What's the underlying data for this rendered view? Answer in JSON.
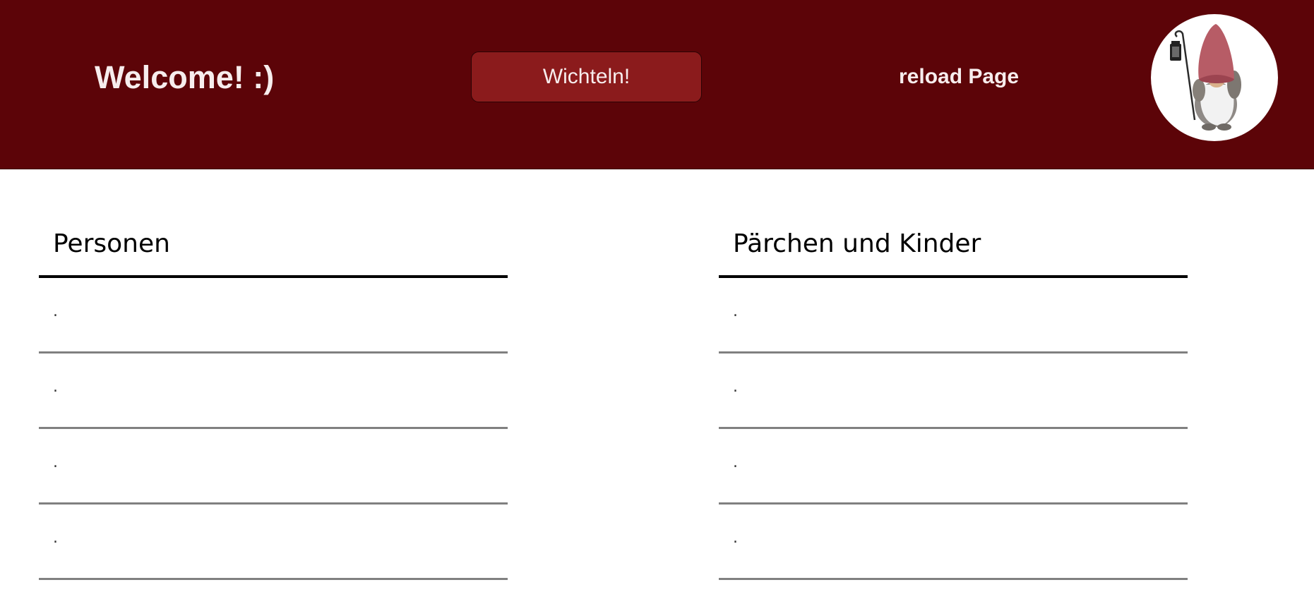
{
  "header": {
    "welcome_text": "Welcome! :)",
    "wichteln_button_label": "Wichteln!",
    "reload_link_label": "reload Page",
    "avatar_icon": "gnome-figurine-icon",
    "background_color": "#5c0408",
    "button_color": "#8b1b1c"
  },
  "lists": [
    {
      "title": "Personen",
      "items": [
        ".",
        ".",
        ".",
        "."
      ]
    },
    {
      "title": "Pärchen und Kinder",
      "items": [
        ".",
        ".",
        ".",
        "."
      ]
    }
  ]
}
